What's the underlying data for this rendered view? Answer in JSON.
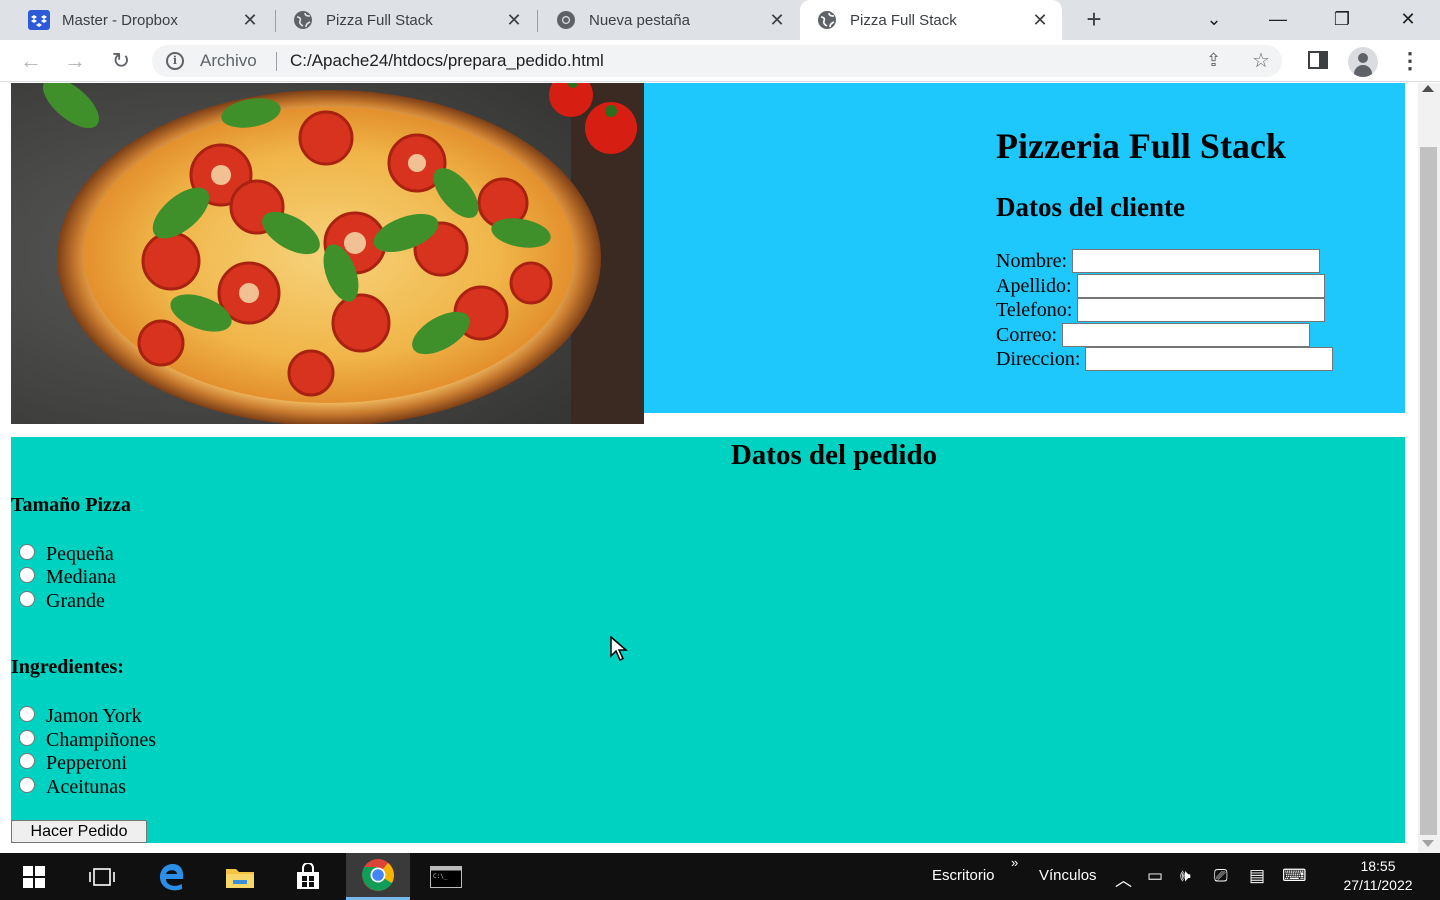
{
  "browser": {
    "tabs": [
      {
        "title": "Master - Dropbox",
        "icon": "dropbox-icon"
      },
      {
        "title": "Pizza Full Stack",
        "icon": "globe-icon"
      },
      {
        "title": "Nueva pestaña",
        "icon": "chrome-icon"
      },
      {
        "title": "Pizza Full Stack",
        "icon": "globe-icon",
        "active": true
      }
    ],
    "address": {
      "scheme_label": "Archivo",
      "url": "C:/Apache24/htdocs/prepara_pedido.html"
    }
  },
  "page": {
    "title": "Pizzeria Full Stack",
    "customer_heading": "Datos del cliente",
    "fields": [
      {
        "label": "Nombre:",
        "value": ""
      },
      {
        "label": "Apellido:",
        "value": ""
      },
      {
        "label": "Telefono:",
        "value": ""
      },
      {
        "label": "Correo:",
        "value": ""
      },
      {
        "label": "Direccion:",
        "value": ""
      }
    ],
    "order_heading": "Datos del pedido",
    "size_heading": "Tamaño Pizza",
    "sizes": [
      "Pequeña",
      "Mediana",
      "Grande"
    ],
    "ingredients_heading": "Ingredientes:",
    "ingredients": [
      "Jamon York",
      "Champiñones",
      "Pepperoni",
      "Aceitunas"
    ],
    "submit_label": "Hacer Pedido",
    "colors": {
      "header_bg": "#1ec8fc",
      "order_bg": "#00d2c1"
    }
  },
  "taskbar": {
    "toolbar_escritorio": "Escritorio",
    "toolbar_vinculos": "Vínculos",
    "time": "18:55",
    "date": "27/11/2022"
  }
}
